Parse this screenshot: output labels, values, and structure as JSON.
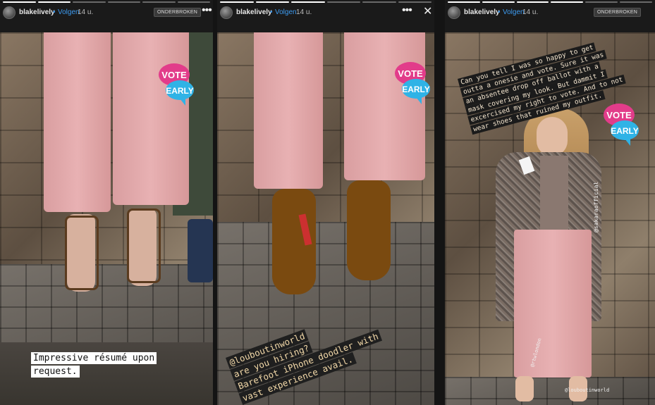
{
  "colors": {
    "follow": "#3d9bf0",
    "pants": "#e2a7a8",
    "topbar": "#1a1a1a"
  },
  "stories": [
    {
      "username": "blakelively",
      "separator": "•",
      "follow_label": "Volgen",
      "time": "14 u.",
      "badge": "ONDERBROKEN",
      "more_icon": "more-dots-icon",
      "caption": [
        "Impressive résumé upon",
        "request."
      ],
      "sticker": {
        "line1": "VOTE",
        "line2": "EARLY"
      }
    },
    {
      "username": "blakelively",
      "separator": "•",
      "follow_label": "Volgen",
      "time": "14 u.",
      "more_icon": "more-dots-icon",
      "close_icon": "close-icon",
      "caption": [
        "@louboutinworld",
        "are you hiring?",
        "Barefoot iPhone doodler with",
        "vast experience avail."
      ],
      "sticker": {
        "line1": "VOTE",
        "line2": "EARLY"
      }
    },
    {
      "username": "blakelively",
      "separator": "•",
      "follow_label": "Volgen",
      "time": "14 u.",
      "badge": "ONDERBROKEN",
      "caption": [
        "Can you tell I was so happy to get",
        "outta a onesie and vote. Sure it was",
        "an absentee drop off ballot with a",
        "mask covering my look. But dammit I",
        "excercised my right to vote. And to not",
        "wear shoes that ruined my outfit."
      ],
      "sticker": {
        "line1": "VOTE",
        "line2": "EARLY"
      },
      "tags": [
        "@sakaraofficial",
        "@rtwlondon",
        "@louboutinworld"
      ]
    }
  ]
}
